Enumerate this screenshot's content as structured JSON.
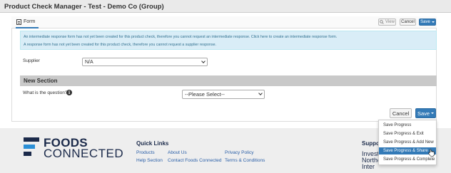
{
  "header": {
    "title": "Product Check Manager - Test - Demo Co (Group)"
  },
  "toolbar": {
    "form_tab_label": "Form",
    "view_label": "View",
    "cancel_label": "Cancel",
    "save_label": "Save"
  },
  "alert": {
    "line1": "An intermediate response form has not yet been created for this product check, therefore you cannot request an intermediate response. Click here to create an intermediate response form.",
    "line2": "A response form has not yet been created for this product check, therefore you cannot request a supplier response."
  },
  "supplier": {
    "label": "Supplier",
    "value": "N/A"
  },
  "section": {
    "title": "New Section",
    "question_label": "What is the question?",
    "question_value": "--Please Select--"
  },
  "actions": {
    "cancel_label": "Cancel",
    "save_label": "Save"
  },
  "save_menu": {
    "items": [
      {
        "label": "Save Progress"
      },
      {
        "label": "Save Progress & Exit"
      },
      {
        "label": "Save Progress & Add New"
      },
      {
        "label": "Save Progress & Share"
      },
      {
        "label": "Save Progress & Complete"
      }
    ],
    "highlighted_index": 3
  },
  "footer": {
    "logo_line1": "FOODS",
    "logo_line2": "CONNECTED",
    "quick_links_title": "Quick Links",
    "links": [
      "Products",
      "About Us",
      "Privacy Policy",
      "Help Section",
      "Contact Foods Connected",
      "Terms & Conditions"
    ],
    "support_title": "Suppo",
    "support_lines": [
      "Invest",
      "Northe",
      "Inter"
    ]
  },
  "colors": {
    "accent": "#337ab7",
    "alert_bg": "#d9edf7",
    "alert_text": "#31708f",
    "brand_navy": "#1b2a4a",
    "logo_blue": "#2b8fd6"
  }
}
